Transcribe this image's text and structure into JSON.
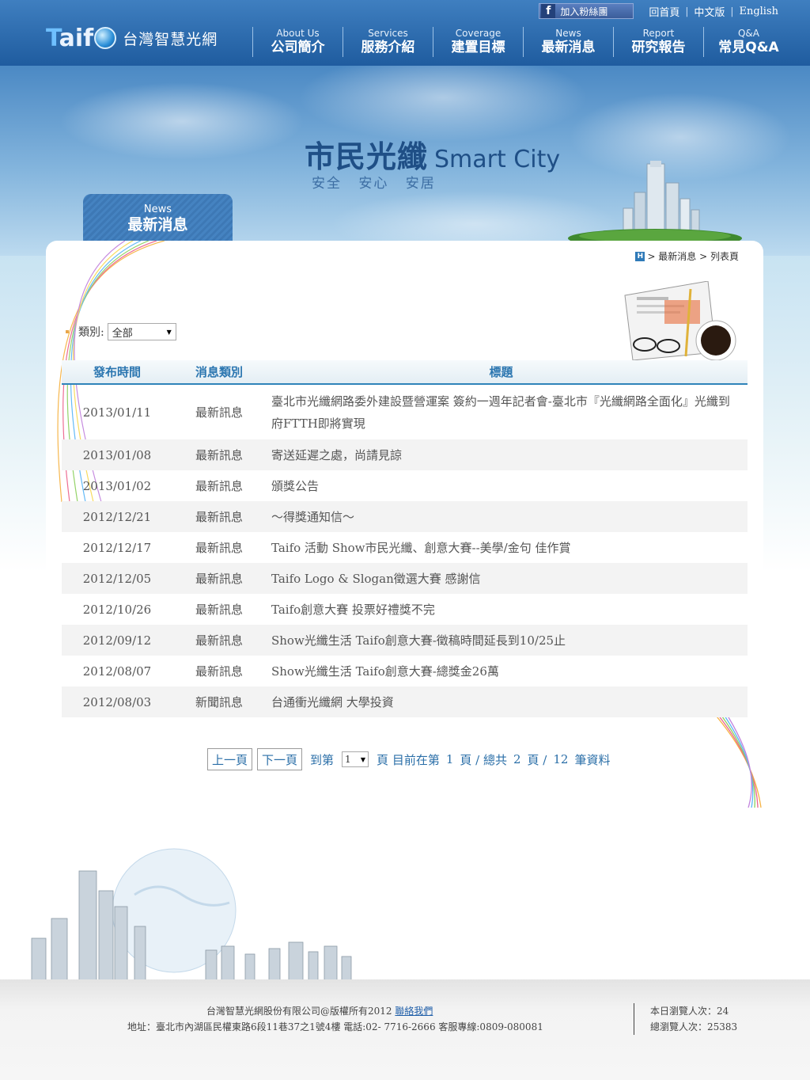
{
  "header": {
    "logo_word_t": "T",
    "logo_word_rest": "aif",
    "logo_cn": "台灣智慧光網",
    "fb_label": "加入粉絲團",
    "fb_glyph": "f",
    "top_links": [
      "回首頁",
      "中文版",
      "English"
    ],
    "nav": [
      {
        "en": "About Us",
        "cn": "公司簡介"
      },
      {
        "en": "Services",
        "cn": "服務介紹"
      },
      {
        "en": "Coverage",
        "cn": "建置目標"
      },
      {
        "en": "News",
        "cn": "最新消息"
      },
      {
        "en": "Report",
        "cn": "研究報告"
      },
      {
        "en": "Q&A",
        "cn": "常見Q&A"
      }
    ]
  },
  "banner": {
    "title_cn": "市民光纖",
    "title_en": "Smart City",
    "subtitle": "安全 安心 安居"
  },
  "section_tab": {
    "en": "News",
    "cn": "最新消息"
  },
  "breadcrumb": {
    "home_glyph": "H",
    "path": "> 最新消息 > 列表頁"
  },
  "filter": {
    "label": "類別:",
    "selected": "全部"
  },
  "table": {
    "headers": [
      "發布時間",
      "消息類別",
      "標題"
    ],
    "rows": [
      {
        "date": "2013/01/11",
        "category": "最新訊息",
        "title": "臺北市光纖網路委外建設暨營運案 簽約一週年記者會-臺北市『光纖網路全面化』光纖到府FTTH即將實現"
      },
      {
        "date": "2013/01/08",
        "category": "最新訊息",
        "title": "寄送延遲之處，尚請見諒"
      },
      {
        "date": "2013/01/02",
        "category": "最新訊息",
        "title": "頒獎公告"
      },
      {
        "date": "2012/12/21",
        "category": "最新訊息",
        "title": "～得獎通知信～"
      },
      {
        "date": "2012/12/17",
        "category": "最新訊息",
        "title": "Taifo 活動 Show市民光纖、創意大賽--美學/金句 佳作賞"
      },
      {
        "date": "2012/12/05",
        "category": "最新訊息",
        "title": "Taifo Logo & Slogan徵選大賽 感謝信"
      },
      {
        "date": "2012/10/26",
        "category": "最新訊息",
        "title": "Taifo創意大賽 投票好禮獎不完"
      },
      {
        "date": "2012/09/12",
        "category": "最新訊息",
        "title": "Show光纖生活 Taifo創意大賽-徵稿時間延長到10/25止"
      },
      {
        "date": "2012/08/07",
        "category": "最新訊息",
        "title": "Show光纖生活 Taifo創意大賽-總獎金26萬"
      },
      {
        "date": "2012/08/03",
        "category": "新聞訊息",
        "title": "台通衝光纖網 大學投資"
      }
    ]
  },
  "pager": {
    "prev": "上一頁",
    "next": "下一頁",
    "goto_prefix": "到第",
    "page_select": "1",
    "goto_suffix": "頁 目前在第",
    "current": "1",
    "total_prefix": "頁 / 總共",
    "total_pages": "2",
    "records_prefix": "頁 /",
    "records": "12",
    "records_suffix": "筆資料"
  },
  "footer": {
    "copyright": "台灣智慧光網股份有限公司@版權所有2012",
    "contact_link": "聯絡我們",
    "address": "地址：臺北市內湖區民權東路6段11巷37之1號4樓 電話:02- 7716-2666 客服專線:0809-080081",
    "today_label": "本日瀏覽人次：",
    "today_count": "24",
    "total_label": "總瀏覽人次：",
    "total_count": "25383"
  }
}
